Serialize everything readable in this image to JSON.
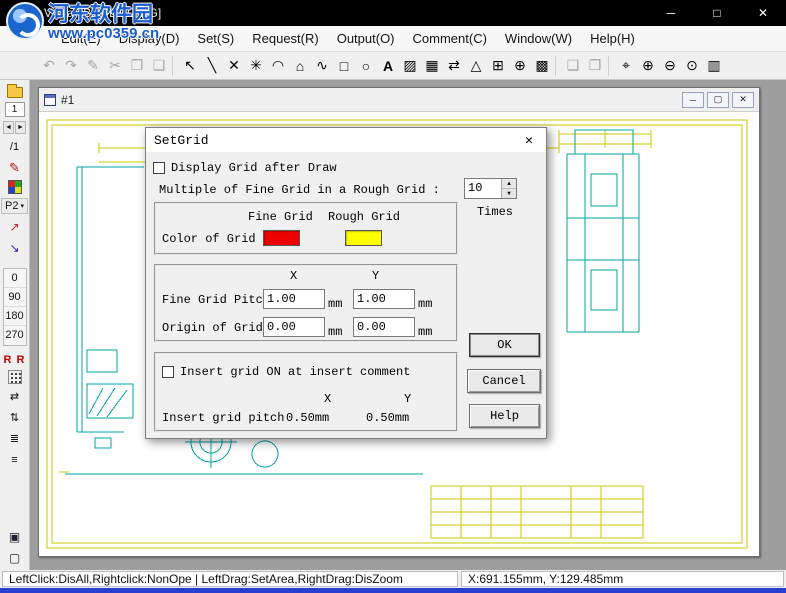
{
  "window": {
    "title": "Visual [BigDEMO.HG]",
    "controls": {
      "minimize": "─",
      "maximize": "□",
      "close": "✕"
    }
  },
  "watermark": {
    "site_name": "河东软件园",
    "site_url": "www.pc0359.cn"
  },
  "menubar": {
    "items": [
      {
        "label": "Edit(E)"
      },
      {
        "label": "Display(D)"
      },
      {
        "label": "Set(S)"
      },
      {
        "label": "Request(R)"
      },
      {
        "label": "Output(O)"
      },
      {
        "label": "Comment(C)"
      },
      {
        "label": "Window(W)"
      },
      {
        "label": "Help(H)"
      }
    ]
  },
  "toolbar": {
    "items": [
      {
        "name": "undo",
        "glyph": "↶"
      },
      {
        "name": "redo",
        "glyph": "↷"
      },
      {
        "name": "pen",
        "glyph": "✎"
      },
      {
        "name": "cut",
        "glyph": "✂"
      },
      {
        "name": "copy",
        "glyph": "❐"
      },
      {
        "name": "paste",
        "glyph": "❏"
      },
      {
        "name": "select",
        "glyph": "↖"
      },
      {
        "name": "line",
        "glyph": "╲"
      },
      {
        "name": "cross-lines",
        "glyph": "✕"
      },
      {
        "name": "point",
        "glyph": "✳"
      },
      {
        "name": "arc",
        "glyph": "◠"
      },
      {
        "name": "polygon",
        "glyph": "⌂"
      },
      {
        "name": "spline",
        "glyph": "∿"
      },
      {
        "name": "rectangle",
        "glyph": "□"
      },
      {
        "name": "ellipse",
        "glyph": "○"
      },
      {
        "name": "text",
        "glyph": "A"
      },
      {
        "name": "hatch",
        "glyph": "▨"
      },
      {
        "name": "grid-pattern",
        "glyph": "▦"
      },
      {
        "name": "dimension",
        "glyph": "⇄"
      },
      {
        "name": "triangle",
        "glyph": "△"
      },
      {
        "name": "mesh",
        "glyph": "⊞"
      },
      {
        "name": "center-mark",
        "glyph": "⊕"
      },
      {
        "name": "fill-grid",
        "glyph": "▩"
      },
      {
        "name": "tile-window",
        "glyph": "❑"
      },
      {
        "name": "cascade-window",
        "glyph": "❒"
      },
      {
        "name": "zoom-window",
        "glyph": "⌖"
      },
      {
        "name": "zoom-in",
        "glyph": "⊕"
      },
      {
        "name": "zoom-out",
        "glyph": "⊖"
      },
      {
        "name": "zoom-fit",
        "glyph": "⊙"
      },
      {
        "name": "pan",
        "glyph": "▥"
      }
    ]
  },
  "sidebar": {
    "page_value": "1",
    "page_suffix": "/1",
    "prev_glyph": "◄",
    "next_glyph": "►",
    "layer_label": "P2",
    "layer_arrow": "▾",
    "angles": [
      "0",
      "90",
      "180",
      "270"
    ],
    "rr_label": "R R",
    "icons": {
      "stamp": "✎",
      "import": "↗",
      "export": "↘",
      "h_arrows": "⇄",
      "v_arrows": "⇅",
      "list1": "≣",
      "list2": "≡",
      "win1": "▣",
      "win2": "▢"
    }
  },
  "child_window": {
    "title": "#1",
    "controls": {
      "minimize": "─",
      "restore": "▢",
      "close": "✕"
    }
  },
  "dialog": {
    "title": "SetGrid",
    "close_glyph": "✕",
    "display_grid_label": "Display Grid after Draw",
    "display_grid_checked": false,
    "multiple_label": "Multiple of Fine Grid in a Rough Grid :",
    "multiple_value": "10",
    "spinner_up": "▲",
    "spinner_down": "▼",
    "times_label": "Times",
    "fine_grid_header": "Fine Grid",
    "rough_grid_header": "Rough Grid",
    "color_label": "Color of Grid",
    "fine_grid_color": "#ee0000",
    "rough_grid_color": "#ffff00",
    "x_header": "X",
    "y_header": "Y",
    "fine_pitch_label": "Fine Grid Pitch",
    "fine_pitch_x": "1.00",
    "fine_pitch_y": "1.00",
    "origin_label": "Origin of Grid",
    "origin_x": "0.00",
    "origin_y": "0.00",
    "unit": "mm",
    "insert_label": "Insert grid ON at insert comment",
    "insert_checked": false,
    "insert_x_header": "X",
    "insert_y_header": "Y",
    "insert_pitch_label": "Insert grid pitch",
    "insert_pitch_x": "0.50mm",
    "insert_pitch_y": "0.50mm",
    "ok_label": "OK",
    "cancel_label": "Cancel",
    "help_label": "Help"
  },
  "statusbar": {
    "left": "LeftClick:DisAll,Rightclick:NonOpe | LeftDrag:SetArea,RightDrag:DisZoom",
    "right": "X:691.155mm, Y:129.485mm"
  },
  "colors": {
    "drawing_frame": "#c9c900",
    "drawing_line": "#00a3a3",
    "taskbar_strip": "#2840d0"
  }
}
